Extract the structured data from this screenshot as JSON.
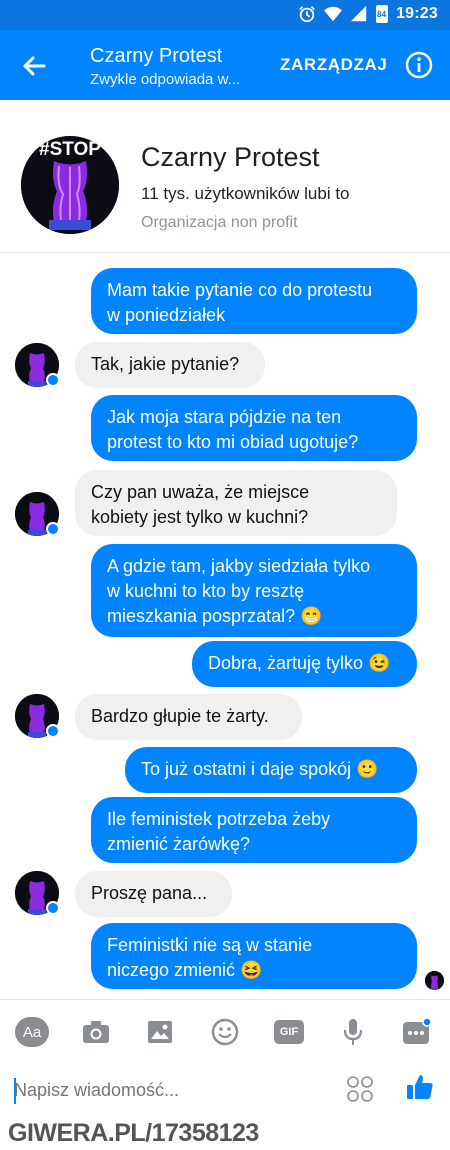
{
  "status_bar": {
    "time": "19:23",
    "battery": "84"
  },
  "header": {
    "title": "Czarny Protest",
    "subtitle": "Zwykle odpowiada w...",
    "manage_label": "ZARZĄDZAJ"
  },
  "page_card": {
    "avatar_text": "#STOP",
    "name": "Czarny Protest",
    "likes": "11 tys. użytkowników lubi to",
    "category": "Organizacja non profit"
  },
  "messages": [
    {
      "from": "me",
      "lines": [
        "Mam takie pytanie co do protestu",
        "w poniedziałek"
      ]
    },
    {
      "from": "page",
      "lines": [
        "Tak, jakie pytanie?"
      ]
    },
    {
      "from": "me",
      "lines": [
        "Jak moja stara pójdzie na ten",
        "protest to kto mi obiad ugotuje?"
      ]
    },
    {
      "from": "page",
      "lines": [
        "Czy pan uważa, że miejsce",
        "kobiety jest tylko w kuchni?"
      ]
    },
    {
      "from": "me",
      "lines": [
        "A gdzie tam, jakby siedziała tylko",
        "w kuchni to kto by resztę",
        "mieszkania posprzatal? 😁"
      ]
    },
    {
      "from": "me",
      "lines": [
        "Dobra, żartuję tylko 😉"
      ]
    },
    {
      "from": "page",
      "lines": [
        "Bardzo głupie te żarty."
      ]
    },
    {
      "from": "me",
      "lines": [
        "To już ostatni i daje spokój 🙂"
      ]
    },
    {
      "from": "me",
      "lines": [
        "Ile feministek potrzeba żeby",
        "zmienić żarówkę?"
      ]
    },
    {
      "from": "page",
      "lines": [
        "Proszę pana..."
      ]
    },
    {
      "from": "me",
      "lines": [
        "Feministki nie są w stanie",
        "niczego zmienić 😆"
      ]
    }
  ],
  "composer": {
    "aa_label": "Aa",
    "gif_label": "GIF",
    "placeholder": "Napisz wiadomość..."
  },
  "watermark": "GIWERA.PL/17358123",
  "colors": {
    "accent": "#0084ff",
    "incoming_bubble": "#f1f0f0",
    "status_bar": "#0b76e0"
  }
}
